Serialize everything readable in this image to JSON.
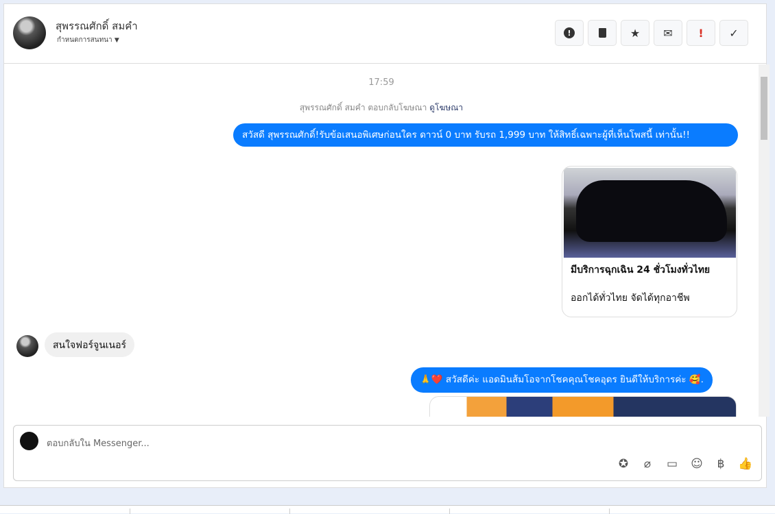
{
  "header": {
    "name": "สุพรรณศักดิ์ สมคำ",
    "subtitle": "กำหนดการสนทนา",
    "dropdown_icon": "caret-down-icon",
    "actions": [
      {
        "name": "report",
        "icon": "alert-circle-icon",
        "glyph": "⬤"
      },
      {
        "name": "delete",
        "icon": "trash-icon",
        "glyph": "🗑"
      },
      {
        "name": "star",
        "icon": "star-icon",
        "glyph": "★"
      },
      {
        "name": "mark-unread",
        "icon": "envelope-icon",
        "glyph": "✉"
      },
      {
        "name": "important",
        "icon": "exclamation-icon",
        "glyph": "!"
      },
      {
        "name": "done",
        "icon": "check-icon",
        "glyph": "✓"
      }
    ]
  },
  "chat": {
    "time": "17:59",
    "ad_note": "สุพรรณศักดิ์ สมคำ ตอบกลับโฆษณา",
    "ad_link": "ดูโฆษณา",
    "msg1": "สวัสดี สุพรรณศักดิ์!รับข้อเสนอพิเศษก่อนใคร ดาวน์ 0 บาท รับรถ 1,999 บาท ให้สิทธิ์เฉพาะผู้ที่เห็นโพสนี้ เท่านั้น!!",
    "card": {
      "title": "มีบริการฉุกเฉิน 24 ชั่วโมงทั่วไทย",
      "subtitle": "ออกได้ทั่วไทย จัดได้ทุกอาชีพ"
    },
    "msg2": "สนใจฟอร์จูนเนอร์",
    "msg3": "🙏❤️ สวัสดีค่ะ แอดมินส้มโอจากโชคคุณโชคอุดร ยินดีให้บริการค่ะ 🥰."
  },
  "composer": {
    "placeholder": "ตอบกลับใน Messenger...",
    "icons": [
      {
        "name": "saved-reply-icon",
        "glyph": "⭐"
      },
      {
        "name": "attach-icon",
        "glyph": "📎"
      },
      {
        "name": "chat-bubble-icon",
        "glyph": "💬"
      },
      {
        "name": "emoji-icon",
        "glyph": "☺"
      },
      {
        "name": "baht-icon",
        "glyph": "฿"
      },
      {
        "name": "like-icon",
        "glyph": "👍"
      }
    ]
  },
  "colors": {
    "accent": "#0a7cff",
    "important": "#d93025"
  }
}
